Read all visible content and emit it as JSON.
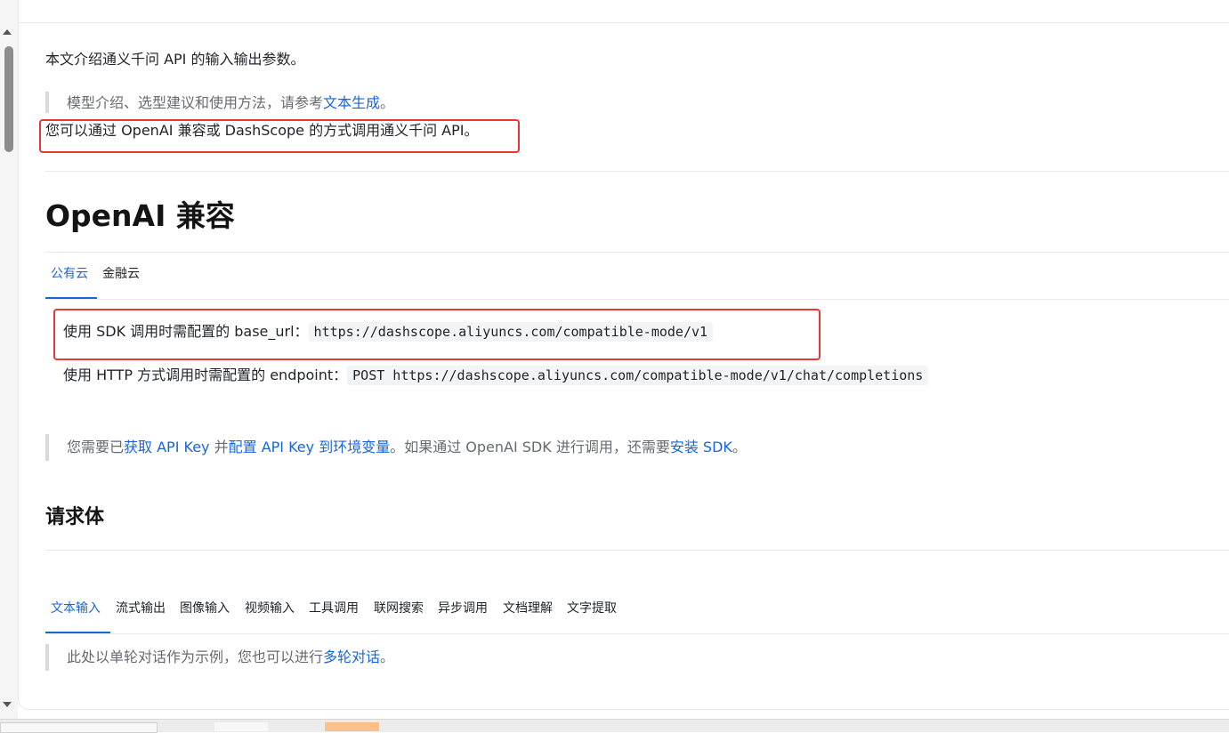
{
  "intro": {
    "line1": "本文介绍通义千问 API 的输入输出参数。",
    "note_prefix": "模型介绍、选型建议和使用方法，请参考",
    "note_link": "文本生成",
    "note_suffix": "。",
    "line2": "您可以通过 OpenAI 兼容或 DashScope 的方式调用通义千问 API。"
  },
  "section_openai": {
    "title": "OpenAI 兼容",
    "tabs": [
      {
        "label": "公有云",
        "active": true
      },
      {
        "label": "金融云",
        "active": false
      }
    ],
    "sdk_label": "使用 SDK 调用时需配置的 base_url：",
    "sdk_url": "https://dashscope.aliyuncs.com/compatible-mode/v1",
    "http_label": "使用 HTTP 方式调用时需配置的 endpoint：",
    "http_endpoint": "POST https://dashscope.aliyuncs.com/compatible-mode/v1/chat/completions",
    "note": {
      "p1": "您需要已",
      "l1": "获取 API Key",
      "p2": " 并",
      "l2": "配置 API Key 到环境变量",
      "p3": "。如果通过 OpenAI SDK 进行调用，还需要",
      "l3": "安装 SDK",
      "p4": "。"
    }
  },
  "section_request": {
    "title": "请求体",
    "tabs": [
      {
        "label": "文本输入",
        "active": true
      },
      {
        "label": "流式输出",
        "active": false
      },
      {
        "label": "图像输入",
        "active": false
      },
      {
        "label": "视频输入",
        "active": false
      },
      {
        "label": "工具调用",
        "active": false
      },
      {
        "label": "联网搜索",
        "active": false
      },
      {
        "label": "异步调用",
        "active": false
      },
      {
        "label": "文档理解",
        "active": false
      },
      {
        "label": "文字提取",
        "active": false
      }
    ],
    "note_prefix": "此处以单轮对话作为示例，您也可以进行",
    "note_link": "多轮对话",
    "note_suffix": "。"
  },
  "colors": {
    "accent": "#1766d9",
    "highlight_box": "#e53935",
    "muted_text": "#666a70"
  }
}
